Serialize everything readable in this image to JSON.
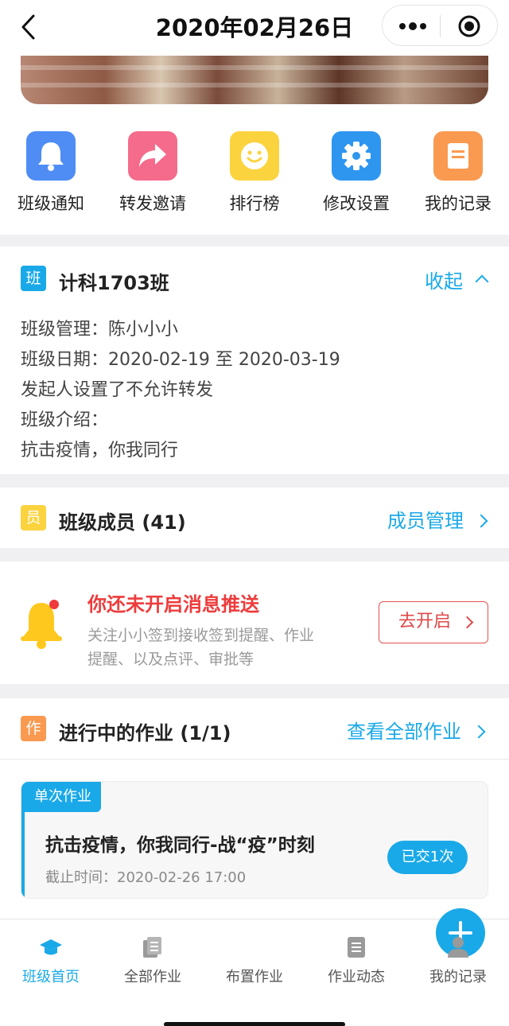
{
  "header": {
    "title": "2020年02月26日"
  },
  "quick_actions": [
    {
      "label": "班级通知",
      "icon": "bell-icon",
      "color": "#4f8df5"
    },
    {
      "label": "转发邀请",
      "icon": "share-icon",
      "color": "#f56b8c"
    },
    {
      "label": "排行榜",
      "icon": "smile-icon",
      "color": "#fbd33f"
    },
    {
      "label": "修改设置",
      "icon": "gear-icon",
      "color": "#2f96f0"
    },
    {
      "label": "我的记录",
      "icon": "note-icon",
      "color": "#f99a50"
    }
  ],
  "class_info": {
    "tag": "班",
    "name": "计科1703班",
    "toggle_label": "收起",
    "manager": "班级管理：陈小小小",
    "dates": "班级日期：2020-02-19 至 2020-03-19",
    "forward_note": "发起人设置了不允许转发",
    "intro_label": "班级介绍：",
    "intro_text": "抗击疫情，你我同行"
  },
  "members": {
    "tag": "员",
    "title": "班级成员 (41)",
    "manage_label": "成员管理"
  },
  "push": {
    "title": "你还未开启消息推送",
    "desc_line1": "关注小小签到接收签到提醒、作业",
    "desc_line2": "提醒、以及点评、审批等",
    "button_label": "去开启"
  },
  "homework": {
    "tag": "作",
    "title": "进行中的作业 (1/1)",
    "view_all_label": "查看全部作业",
    "item": {
      "badge": "单次作业",
      "title": "抗击疫情，你我同行-战“疫”时刻",
      "deadline": "截止时间：2020-02-26 17:00",
      "status": "已交1次"
    }
  },
  "tabbar": [
    {
      "label": "班级首页",
      "icon": "graduation-cap-icon",
      "active": true
    },
    {
      "label": "全部作业",
      "icon": "documents-icon",
      "active": false
    },
    {
      "label": "布置作业",
      "icon": "plus-icon",
      "active": false
    },
    {
      "label": "作业动态",
      "icon": "document-icon",
      "active": false
    },
    {
      "label": "我的记录",
      "icon": "user-icon",
      "active": false
    }
  ],
  "colors": {
    "accent": "#1aa9e8",
    "alert": "#ee3b3b"
  }
}
